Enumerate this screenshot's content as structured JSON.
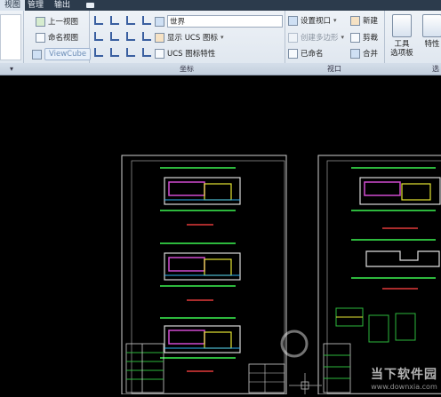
{
  "tabs": [
    {
      "label": "视图",
      "active": true
    },
    {
      "label": "管理",
      "active": false
    },
    {
      "label": "输出",
      "active": false
    }
  ],
  "views_panel": {
    "prev_view": "上一视图",
    "named_views": "命名视图",
    "viewcube": "ViewCube"
  },
  "coordinates_panel": {
    "title": "坐标",
    "world": "世界",
    "show_ucs_icon": "显示 UCS 图标",
    "ucs_icon_props": "UCS 图标特性"
  },
  "viewport_panel": {
    "title": "视口",
    "set_viewport": "设置视口",
    "create_polygonal": "创建多边形",
    "named": "已命名",
    "new": "新建",
    "clip": "剪裁",
    "join": "合并"
  },
  "tools": {
    "palettes_l1": "工具",
    "palettes_l2": "选项板",
    "properties": "特性"
  },
  "watermark": {
    "title": "当下软件园",
    "url": "www.downxia.com"
  }
}
